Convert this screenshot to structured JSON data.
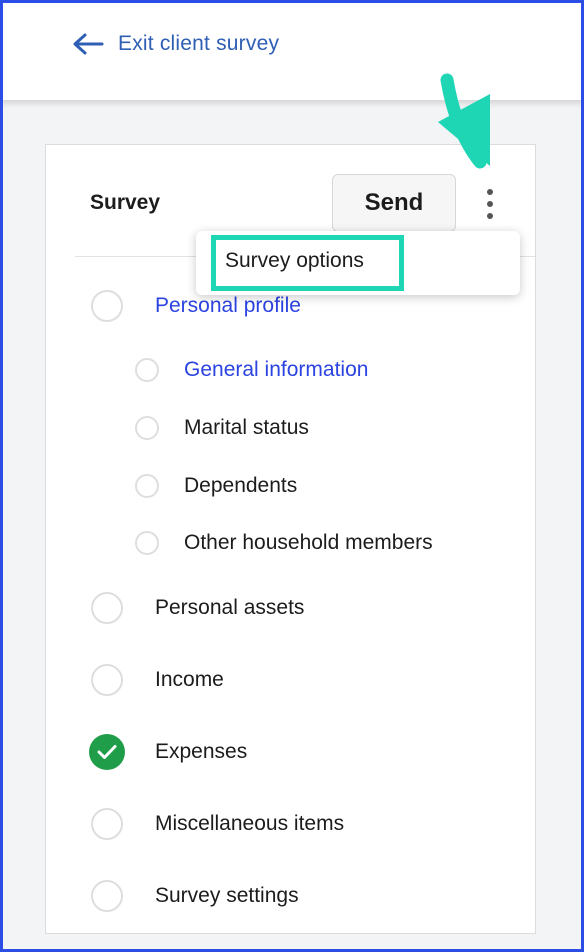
{
  "header": {
    "exit_label": "Exit client survey",
    "back_icon": "arrow-left-icon"
  },
  "card": {
    "title": "Survey",
    "send_label": "Send",
    "menu_icon": "kebab-menu-icon"
  },
  "dropdown": {
    "items": [
      {
        "label": "Survey options"
      }
    ]
  },
  "sections": [
    {
      "label": "Personal profile",
      "level": 1,
      "status": "incomplete",
      "active": true
    },
    {
      "label": "General information",
      "level": 2,
      "status": "incomplete",
      "active": true
    },
    {
      "label": "Marital status",
      "level": 2,
      "status": "incomplete",
      "active": false
    },
    {
      "label": "Dependents",
      "level": 2,
      "status": "incomplete",
      "active": false
    },
    {
      "label": "Other household members",
      "level": 2,
      "status": "incomplete",
      "active": false
    },
    {
      "label": "Personal assets",
      "level": 1,
      "status": "incomplete",
      "active": false
    },
    {
      "label": "Income",
      "level": 1,
      "status": "incomplete",
      "active": false
    },
    {
      "label": "Expenses",
      "level": 1,
      "status": "complete",
      "active": false
    },
    {
      "label": "Miscellaneous items",
      "level": 1,
      "status": "incomplete",
      "active": false
    },
    {
      "label": "Survey settings",
      "level": 1,
      "status": "incomplete",
      "active": false
    }
  ],
  "colors": {
    "link": "#2b43e0",
    "complete": "#1f9d48",
    "annotation": "#1fd6b4",
    "frame": "#2c4de6"
  }
}
